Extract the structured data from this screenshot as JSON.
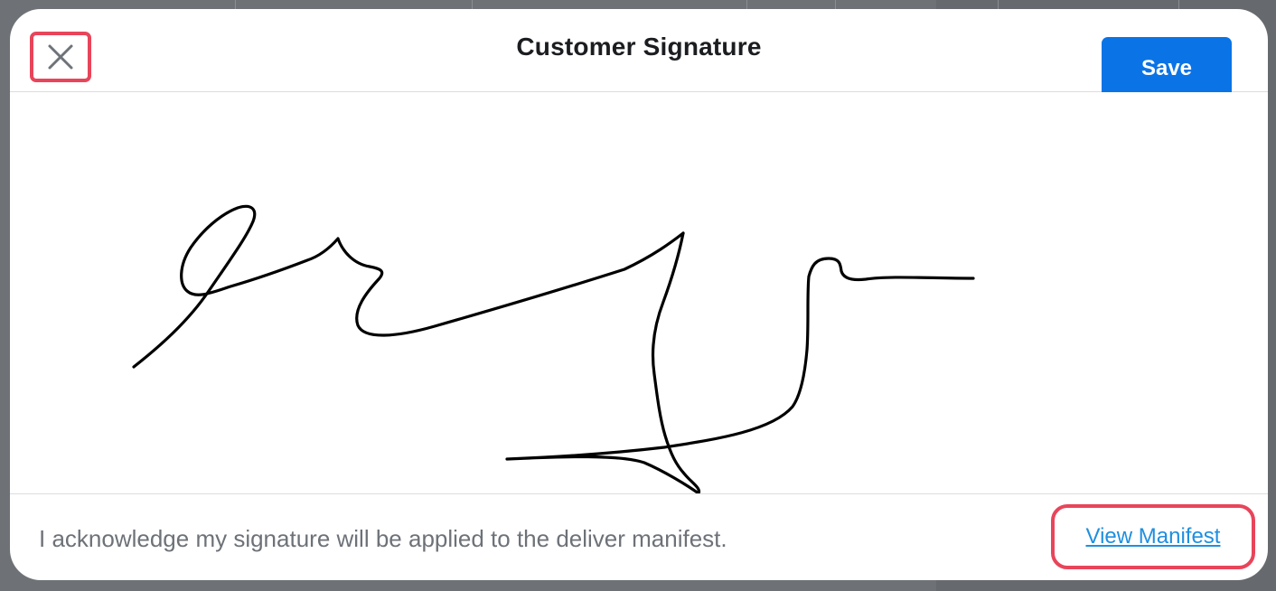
{
  "modal": {
    "title": "Customer Signature",
    "save_label": "Save",
    "close_icon": "close-icon"
  },
  "footer": {
    "acknowledgement": "I acknowledge my signature will be applied to the deliver manifest.",
    "view_manifest_label": "View Manifest"
  },
  "colors": {
    "accent": "#0a74e6",
    "link": "#1f8fe0",
    "highlight": "#e8455a",
    "ink": "#000000"
  }
}
